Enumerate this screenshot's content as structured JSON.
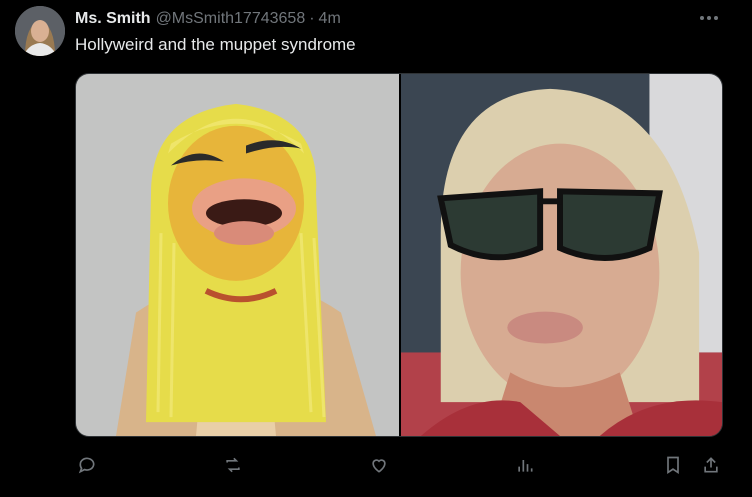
{
  "tweet": {
    "author_name": "Ms. Smith",
    "author_handle": "@MsSmith17743658",
    "separator": "·",
    "time": "4m",
    "text": "Hollyweird and the muppet syndrome"
  },
  "media": {
    "images": [
      {
        "subject": "yellow muppet puppet with blonde yarn hair"
      },
      {
        "subject": "woman with blonde hair wearing dark sunglasses"
      }
    ]
  },
  "actions": {
    "icons": [
      "reply-icon",
      "retweet-icon",
      "like-icon",
      "views-icon",
      "bookmark-icon",
      "share-icon"
    ]
  },
  "colors": {
    "background": "#000000",
    "primary_text": "#e7e9ea",
    "secondary_text": "#71767b",
    "border": "#2f3336"
  }
}
